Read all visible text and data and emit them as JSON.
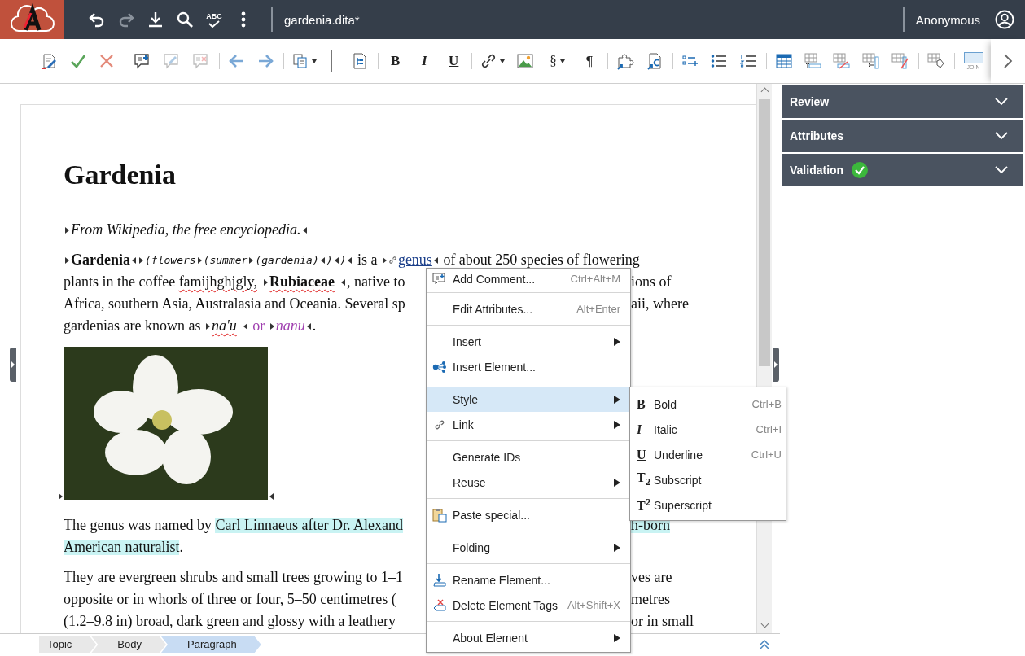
{
  "topbar": {
    "spellcheck_label": "ABC",
    "redo": {
      "disabled": true
    },
    "file_title": "gardenia.dita*",
    "user": "Anonymous"
  },
  "toolbar": {
    "edit_comment": {
      "disabled": true
    },
    "remove_comment": {
      "disabled": true
    },
    "bold": "B",
    "italic": "I",
    "underline": "U",
    "section": "§",
    "pilcrow": "¶",
    "join": "JOIN"
  },
  "document": {
    "title": "Gardenia",
    "blocks": [
      {
        "kind": "para",
        "lines": [
          {
            "left": [
              {
                "kind": "open"
              },
              {
                "kind": "italic",
                "text": "From Wikipedia, the free encyclopedia."
              },
              {
                "kind": "close"
              }
            ]
          }
        ]
      },
      {
        "kind": "para",
        "lines": [
          {
            "left": [
              {
                "kind": "open"
              },
              {
                "kind": "bold",
                "text": "Gardenia"
              },
              {
                "kind": "close"
              },
              {
                "kind": "open"
              },
              {
                "kind": "mono",
                "text": "(flowers"
              },
              {
                "kind": "open"
              },
              {
                "kind": "mono",
                "text": "(summer"
              },
              {
                "kind": "open"
              },
              {
                "kind": "mono",
                "text": "(gardenia)"
              },
              {
                "kind": "close"
              },
              {
                "kind": "mono",
                "text": ")"
              },
              {
                "kind": "close"
              },
              {
                "kind": "mono",
                "text": ")"
              },
              {
                "kind": "close"
              },
              {
                "kind": "text",
                "text": " is a "
              },
              {
                "kind": "open"
              },
              {
                "kind": "link",
                "text": "genus"
              },
              {
                "kind": "close"
              },
              {
                "kind": "text",
                "text": " of about 250 species of flowering"
              }
            ]
          },
          {
            "left": [
              {
                "kind": "text",
                "text": "plants in the coffee "
              },
              {
                "kind": "misspelled",
                "text": "famijhghjgly,"
              },
              {
                "kind": "open"
              },
              {
                "kind": "bold-misspelled",
                "text": "Rubiaceae"
              },
              {
                "kind": "close"
              },
              {
                "kind": "text",
                "text": ", native to"
              }
            ],
            "right": [
              {
                "kind": "text",
                "text": "ions of"
              }
            ]
          },
          {
            "left": [
              {
                "kind": "text",
                "text": "Africa, southern Asia, Australasia and Oceania. Several sp"
              }
            ],
            "right": [
              {
                "kind": "text",
                "text": "aii, where"
              }
            ]
          },
          {
            "left": [
              {
                "kind": "text",
                "text": "gardenias are known as "
              },
              {
                "kind": "open"
              },
              {
                "kind": "italic-misspelled",
                "text": "na'u"
              },
              {
                "kind": "close"
              },
              {
                "kind": "deleted",
                "text": " or "
              },
              {
                "kind": "open"
              },
              {
                "kind": "deleted-italic",
                "text": "nanu"
              },
              {
                "kind": "close"
              },
              {
                "kind": "text",
                "text": "."
              }
            ]
          }
        ]
      },
      {
        "kind": "image"
      },
      {
        "kind": "para",
        "lines": [
          {
            "left": [
              {
                "kind": "text",
                "text": "The genus was named by "
              },
              {
                "kind": "highlight",
                "text": "Carl Linnaeus after Dr. Alexand"
              }
            ],
            "right": [
              {
                "kind": "highlight",
                "text": "h-born"
              }
            ]
          },
          {
            "left": [
              {
                "kind": "highlight",
                "text": "American naturalist"
              },
              {
                "kind": "text",
                "text": "."
              }
            ]
          }
        ]
      },
      {
        "kind": "para",
        "lines": [
          {
            "left": [
              {
                "kind": "text",
                "text": "They are evergreen shrubs and small trees growing to 1–1"
              }
            ],
            "right": [
              {
                "kind": "text",
                "text": "ves are"
              }
            ]
          },
          {
            "left": [
              {
                "kind": "text",
                "text": "opposite or in whorls of three or four, 5–50 centimetres ("
              }
            ],
            "right": [
              {
                "kind": "text",
                "text": "metres"
              }
            ]
          },
          {
            "left": [
              {
                "kind": "text",
                "text": "(1.2–9.8 in) broad, dark green and glossy with a leathery"
              }
            ],
            "right": [
              {
                "kind": "text",
                "text": "or in small"
              }
            ]
          }
        ]
      }
    ]
  },
  "breadcrumb": [
    {
      "label": "Topic",
      "selected": false
    },
    {
      "label": "Body",
      "selected": false
    },
    {
      "label": "Paragraph",
      "selected": true
    }
  ],
  "side_panel": [
    {
      "label": "Review",
      "kind": "plain",
      "expanded": false
    },
    {
      "label": "Attributes",
      "kind": "plain",
      "expanded": false
    },
    {
      "label": "Validation",
      "kind": "validation",
      "expanded": false
    }
  ],
  "context_menu": {
    "groups": [
      [
        {
          "label": "Add Comment...",
          "kind": "comment",
          "shortcut": "Ctrl+Alt+M",
          "submenu": false,
          "selected": false
        }
      ],
      [
        {
          "label": "Edit Attributes...",
          "kind": "plain",
          "shortcut": "Alt+Enter",
          "submenu": false,
          "selected": false
        }
      ],
      [
        {
          "label": "Insert",
          "kind": "plain",
          "submenu": true,
          "selected": false
        },
        {
          "label": "Insert Element...",
          "kind": "element",
          "submenu": false,
          "selected": false
        }
      ],
      [
        {
          "label": "Style",
          "kind": "plain",
          "submenu": true,
          "selected": true
        },
        {
          "label": "Link",
          "kind": "link",
          "submenu": true,
          "selected": false
        }
      ],
      [
        {
          "label": "Generate IDs",
          "kind": "plain",
          "submenu": false,
          "selected": false
        },
        {
          "label": "Reuse",
          "kind": "plain",
          "submenu": true,
          "selected": false
        }
      ],
      [
        {
          "label": "Paste special...",
          "kind": "paste",
          "submenu": false,
          "selected": false
        }
      ],
      [
        {
          "label": "Folding",
          "kind": "plain",
          "submenu": true,
          "selected": false
        }
      ],
      [
        {
          "label": "Rename Element...",
          "kind": "rename",
          "submenu": false,
          "selected": false
        },
        {
          "label": "Delete Element Tags",
          "kind": "delete",
          "shortcut": "Alt+Shift+X",
          "submenu": false,
          "selected": false
        }
      ],
      [
        {
          "label": "About Element",
          "kind": "plain",
          "submenu": true,
          "selected": false
        }
      ]
    ]
  },
  "style_submenu": [
    {
      "glyph": "B",
      "kind": "bold",
      "label": "Bold",
      "shortcut": "Ctrl+B"
    },
    {
      "glyph": "I",
      "kind": "italic",
      "label": "Italic",
      "shortcut": "Ctrl+I"
    },
    {
      "glyph": "U",
      "kind": "underline",
      "label": "Underline",
      "shortcut": "Ctrl+U"
    },
    {
      "glyph": "T$_{2}$",
      "kind": "plain",
      "label": "Subscript"
    },
    {
      "glyph": "T$^{2}$",
      "kind": "plain",
      "label": "Superscript"
    }
  ]
}
